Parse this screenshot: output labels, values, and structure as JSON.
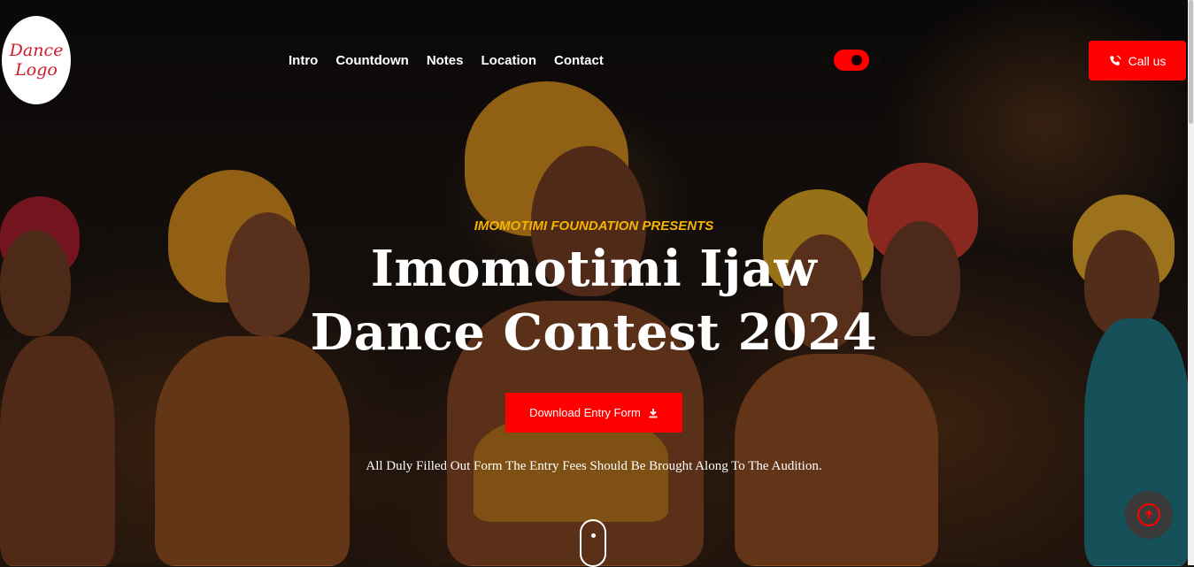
{
  "logo": {
    "text": "Dance Logo"
  },
  "nav": {
    "items": [
      {
        "label": "Intro"
      },
      {
        "label": "Countdown"
      },
      {
        "label": "Notes"
      },
      {
        "label": "Location"
      },
      {
        "label": "Contact"
      }
    ]
  },
  "theme_toggle": {
    "state": "dark",
    "moon_icon": "moon-icon",
    "sun_icon": "gear-sun-icon"
  },
  "call_button": {
    "label": "Call us",
    "icon": "phone-icon"
  },
  "hero": {
    "kicker": "IMOMOTIMI FOUNDATION PRESENTS",
    "title_line1": "Imomotimi Ijaw",
    "title_line2": "Dance Contest 2024",
    "download_label": "Download Entry Form",
    "note": "All Duly Filled Out Form The Entry Fees Should Be Brought Along To The Audition."
  },
  "colors": {
    "accent": "#ff0000",
    "kicker": "#f5b400"
  }
}
